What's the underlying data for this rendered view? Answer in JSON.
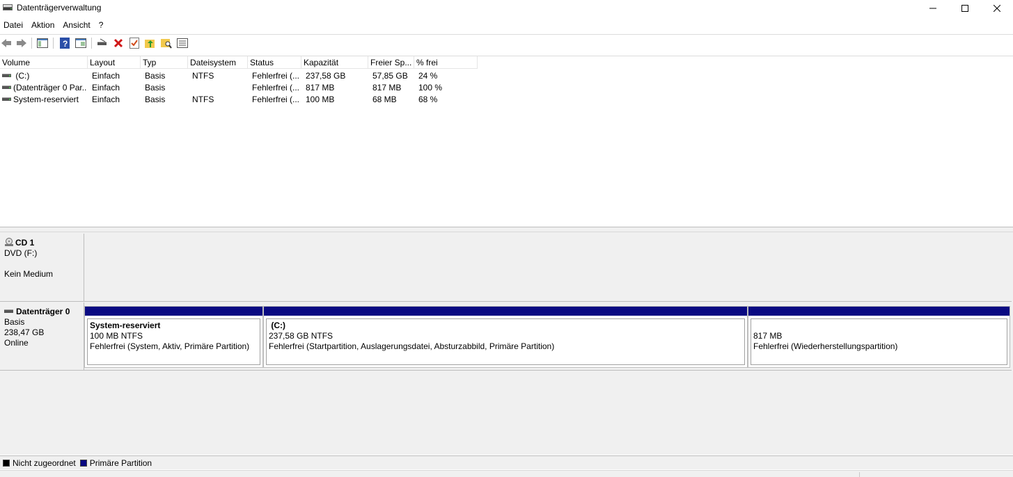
{
  "window": {
    "title": "Datenträgerverwaltung",
    "icon": "disk-management-icon"
  },
  "menu": [
    "Datei",
    "Aktion",
    "Ansicht",
    "?"
  ],
  "toolbar": {
    "icons": [
      "back-arrow-icon",
      "forward-arrow-icon",
      "console-tree-icon",
      "help-icon",
      "properties-icon",
      "connect-disk-icon",
      "delete-icon",
      "check-icon",
      "up-folder-icon",
      "search-folder-icon",
      "list-view-icon"
    ]
  },
  "volume_list": {
    "columns": [
      "Volume",
      "Layout",
      "Typ",
      "Dateisystem",
      "Status",
      "Kapazität",
      "Freier Sp...",
      "% frei"
    ],
    "rows": [
      {
        "volume": " (C:)",
        "layout": "Einfach",
        "typ": "Basis",
        "fs": "NTFS",
        "status": "Fehlerfrei (...",
        "capacity": "237,58 GB",
        "free": "57,85 GB",
        "pct": "24 %"
      },
      {
        "volume": "(Datenträger 0 Par...",
        "layout": "Einfach",
        "typ": "Basis",
        "fs": "",
        "status": "Fehlerfrei (...",
        "capacity": "817 MB",
        "free": "817 MB",
        "pct": "100 %"
      },
      {
        "volume": "System-reserviert",
        "layout": "Einfach",
        "typ": "Basis",
        "fs": "NTFS",
        "status": "Fehlerfrei (...",
        "capacity": "100 MB",
        "free": "68 MB",
        "pct": "68 %"
      }
    ]
  },
  "disks": {
    "cd": {
      "name": "CD 1",
      "line1": "DVD (F:)",
      "line2": "Kein Medium"
    },
    "disk0": {
      "name": "Datenträger 0",
      "type": "Basis",
      "size": "238,47 GB",
      "state": "Online",
      "partitions": [
        {
          "name": "System-reserviert",
          "size": "100 MB NTFS",
          "status": "Fehlerfrei (System, Aktiv, Primäre Partition)"
        },
        {
          "name": " (C:)",
          "size": "237,58 GB NTFS",
          "status": "Fehlerfrei (Startpartition, Auslagerungsdatei, Absturzabbild, Primäre Partition)"
        },
        {
          "name": "",
          "size": "817 MB",
          "status": "Fehlerfrei (Wiederherstellungspartition)"
        }
      ]
    }
  },
  "legend": [
    {
      "label": "Nicht zugeordnet",
      "color": "#000000"
    },
    {
      "label": "Primäre Partition",
      "color": "#0a0a82"
    }
  ],
  "colors": {
    "primary_partition": "#0a0a82",
    "unallocated": "#000000"
  }
}
